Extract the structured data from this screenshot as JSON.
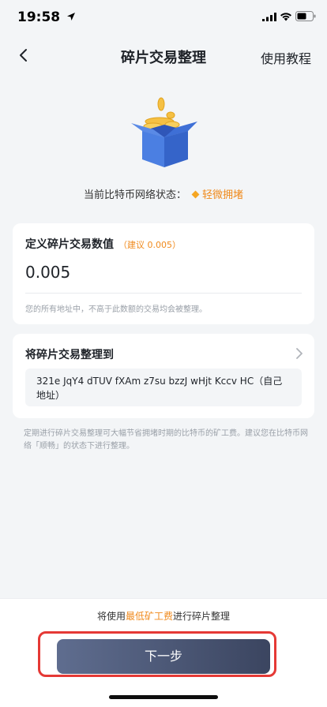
{
  "status_bar": {
    "time": "19:58"
  },
  "nav": {
    "title": "碎片交易整理",
    "action": "使用教程"
  },
  "network": {
    "label": "当前比特币网络状态：",
    "value": "轻微拥堵"
  },
  "amount_card": {
    "title": "定义碎片交易数值",
    "hint": "（建议 0.005）",
    "value": "0.005",
    "note": "您的所有地址中，不高于此数额的交易均会被整理。"
  },
  "address_card": {
    "title": "将碎片交易整理到",
    "address": "321e JqY4 dTUV fXAm z7su bzzJ wHjt Kccv HC（自己地址）"
  },
  "footnote": "定期进行碎片交易整理可大幅节省拥堵时期的比特币的矿工费。建议您在比特币网络「顺畅」的状态下进行整理。",
  "fee_bar": {
    "prefix": "将使用",
    "highlight": "最低矿工费",
    "suffix": "进行碎片整理"
  },
  "buttons": {
    "next": "下一步"
  },
  "colors": {
    "accent": "#f08a1c",
    "button_start": "#5f6d8f",
    "button_end": "#3b4560",
    "highlight_frame": "#e53935",
    "background": "#f3f5f7"
  },
  "icons": {
    "back": "chevron-left-icon",
    "forward": "chevron-right-icon",
    "hero": "box-with-coins-icon",
    "status": "diamond-icon"
  }
}
